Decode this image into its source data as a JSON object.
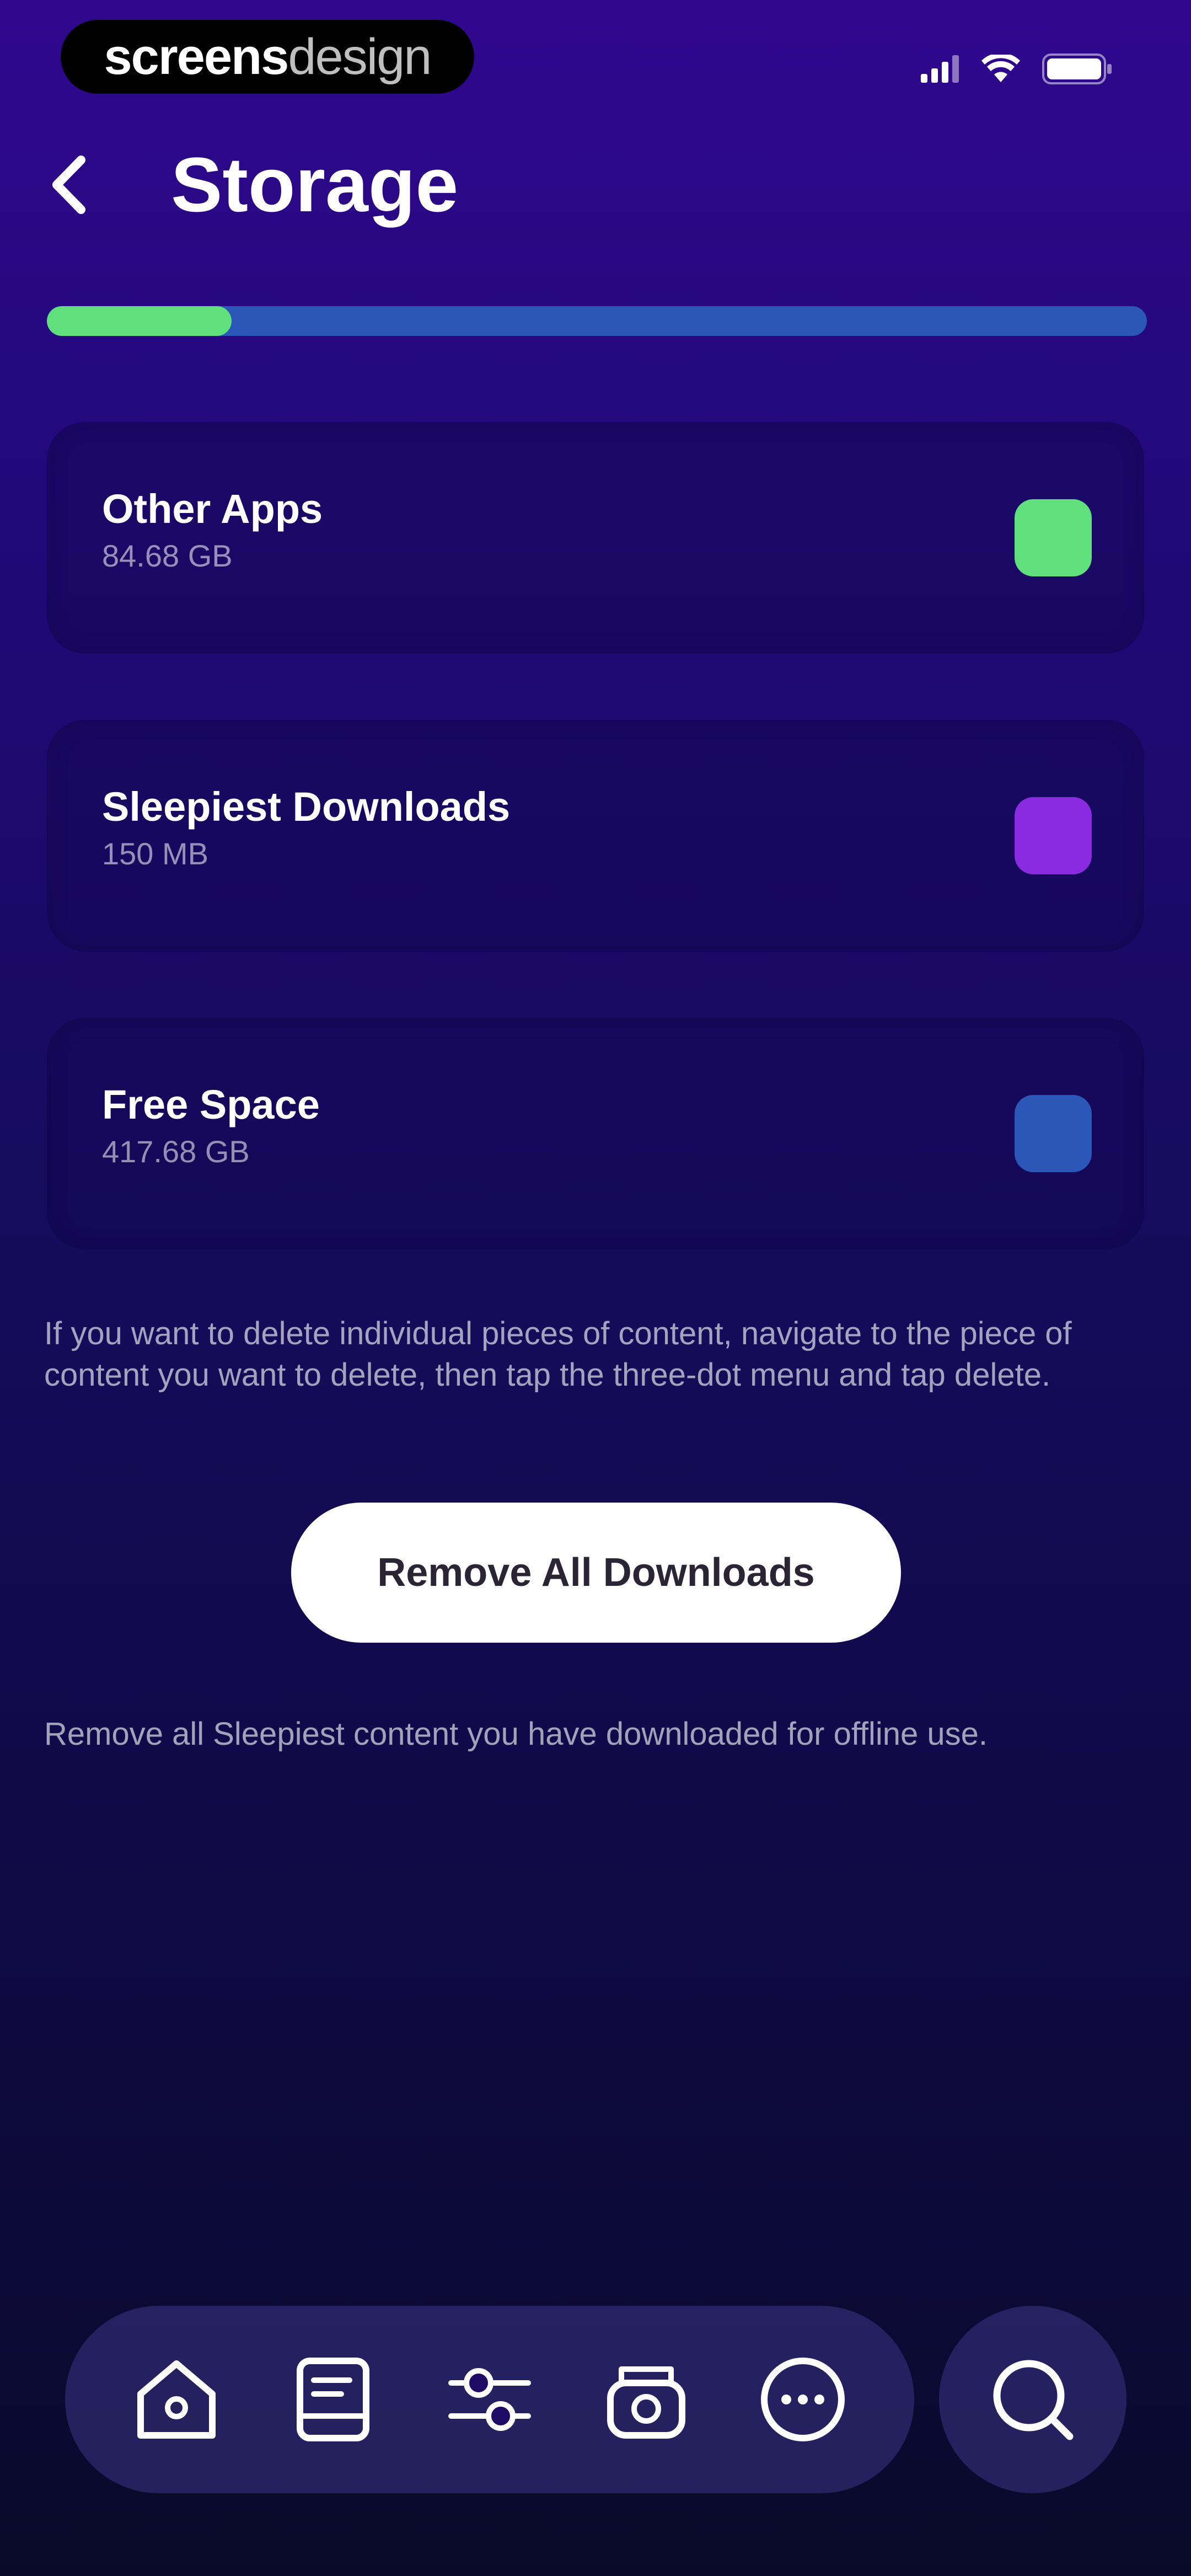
{
  "status_bar": {
    "brand_bold": "screens",
    "brand_light": "design"
  },
  "header": {
    "title": "Storage"
  },
  "storage_bar": {
    "used_fraction": 0.168,
    "used_color": "#5fe07c",
    "track_color": "#2b57b8"
  },
  "storage_items": [
    {
      "label": "Other Apps",
      "size": "84.68 GB",
      "color": "#5fe07c"
    },
    {
      "label": "Sleepiest Downloads",
      "size": "150 MB",
      "color": "#8a2be2"
    },
    {
      "label": "Free Space",
      "size": "417.68 GB",
      "color": "#2b57b8"
    }
  ],
  "info_text": "If you want to delete individual pieces of content, navigate to the piece of content you want to delete, then tap the three-dot menu and tap delete.",
  "remove_button": {
    "label": "Remove All Downloads"
  },
  "remove_note": "Remove all Sleepiest content you have downloaded for offline use.",
  "tab_bar": {
    "tabs": [
      {
        "icon": "home-icon"
      },
      {
        "icon": "journal-icon"
      },
      {
        "icon": "sliders-icon"
      },
      {
        "icon": "radio-icon"
      },
      {
        "icon": "more-icon"
      }
    ],
    "search_icon": "search-icon"
  }
}
